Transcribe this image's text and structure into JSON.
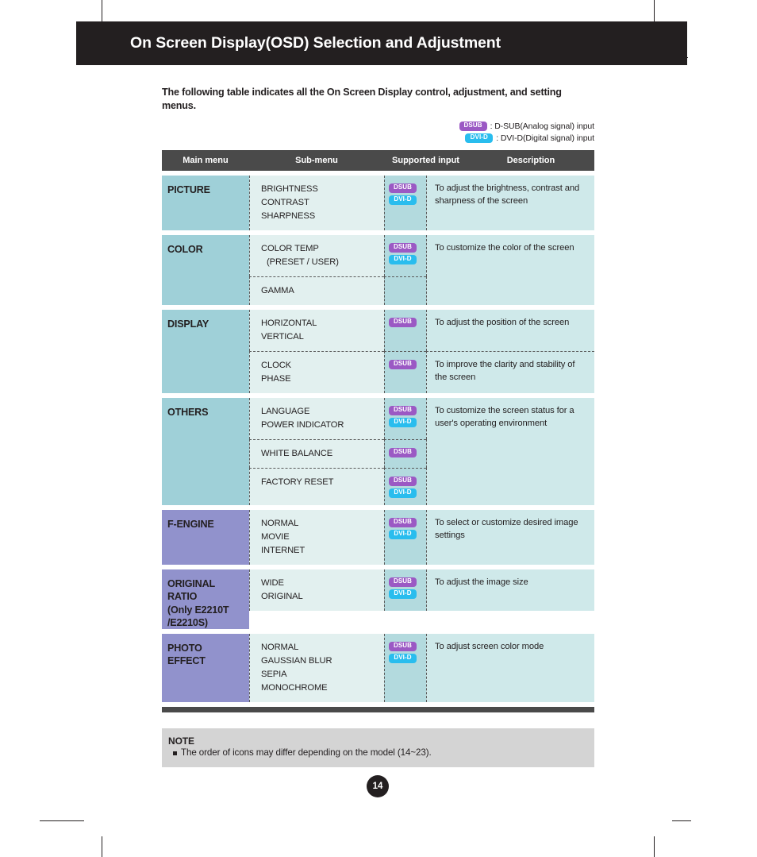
{
  "header": {
    "title": "On Screen Display(OSD) Selection and Adjustment"
  },
  "intro": "The following table indicates all the On Screen Display control, adjustment, and setting menus.",
  "legend": [
    {
      "badge": "DSUB",
      "badge_color": "#9b59c4",
      "text": ": D-SUB(Analog signal) input"
    },
    {
      "badge": "DVI-D",
      "badge_color": "#29bdee",
      "text": ": DVI-D(Digital signal) input"
    }
  ],
  "table": {
    "columns": {
      "main": "Main menu",
      "sub": "Sub-menu",
      "input": "Supported input",
      "description": "Description"
    },
    "header_bg": "#4a4a4a",
    "rows": [
      {
        "main": "PICTURE",
        "main_color": "#9fd0d8",
        "sections": [
          {
            "sub": [
              "BRIGHTNESS",
              "CONTRAST",
              "SHARPNESS"
            ],
            "inputs": [
              "DSUB",
              "DVI-D"
            ],
            "description": "To adjust the brightness, contrast and sharpness of the screen"
          }
        ]
      },
      {
        "main": "COLOR",
        "main_color": "#9fd0d8",
        "sections": [
          {
            "sub": [
              "COLOR TEMP",
              "(PRESET / USER)"
            ],
            "sub_indent": [
              false,
              true
            ],
            "inputs": [
              "DSUB",
              "DVI-D"
            ],
            "description": "To customize the color of the screen"
          },
          {
            "sub": [
              "GAMMA"
            ],
            "inputs": [],
            "description": ""
          }
        ]
      },
      {
        "main": "DISPLAY",
        "main_color": "#9fd0d8",
        "sections": [
          {
            "sub": [
              "HORIZONTAL",
              "VERTICAL"
            ],
            "inputs": [
              "DSUB"
            ],
            "description": "To adjust the position of the screen"
          },
          {
            "sub": [
              "CLOCK",
              "PHASE"
            ],
            "inputs": [
              "DSUB"
            ],
            "description": "To improve the clarity and stability of the screen",
            "divide_description": true
          }
        ]
      },
      {
        "main": "OTHERS",
        "main_color": "#9fd0d8",
        "sections": [
          {
            "sub": [
              "LANGUAGE",
              "POWER INDICATOR"
            ],
            "inputs": [
              "DSUB",
              "DVI-D"
            ],
            "description": "To customize the screen status for a user's operating environment"
          },
          {
            "sub": [
              "WHITE BALANCE"
            ],
            "inputs": [
              "DSUB"
            ],
            "description": ""
          },
          {
            "sub": [
              "FACTORY RESET"
            ],
            "inputs": [
              "DSUB",
              "DVI-D"
            ],
            "description": ""
          }
        ]
      },
      {
        "main": "F-ENGINE",
        "main_color": "#9192cc",
        "sections": [
          {
            "sub": [
              "NORMAL",
              "MOVIE",
              "INTERNET"
            ],
            "inputs": [
              "DSUB",
              "DVI-D"
            ],
            "description": "To select or customize desired image settings"
          }
        ]
      },
      {
        "main": "ORIGINAL RATIO\n(Only E2210T\n/E2210S)",
        "main_lines": [
          "ORIGINAL",
          "RATIO",
          "(Only E2210T",
          "/E2210S)"
        ],
        "main_color": "#9192cc",
        "sections": [
          {
            "sub": [
              "WIDE",
              "ORIGINAL"
            ],
            "inputs": [
              "DSUB",
              "DVI-D"
            ],
            "description": "To adjust the image size"
          }
        ]
      },
      {
        "main": "PHOTO EFFECT",
        "main_lines": [
          "PHOTO",
          "EFFECT"
        ],
        "main_color": "#9192cc",
        "sections": [
          {
            "sub": [
              "NORMAL",
              "GAUSSIAN BLUR",
              "SEPIA",
              "MONOCHROME"
            ],
            "inputs": [
              "DSUB",
              "DVI-D"
            ],
            "description": "To adjust screen color mode"
          }
        ]
      }
    ]
  },
  "note": {
    "title": "NOTE",
    "items": [
      "The order of icons may differ depending on the model (14~23)."
    ]
  },
  "page_number": "14"
}
